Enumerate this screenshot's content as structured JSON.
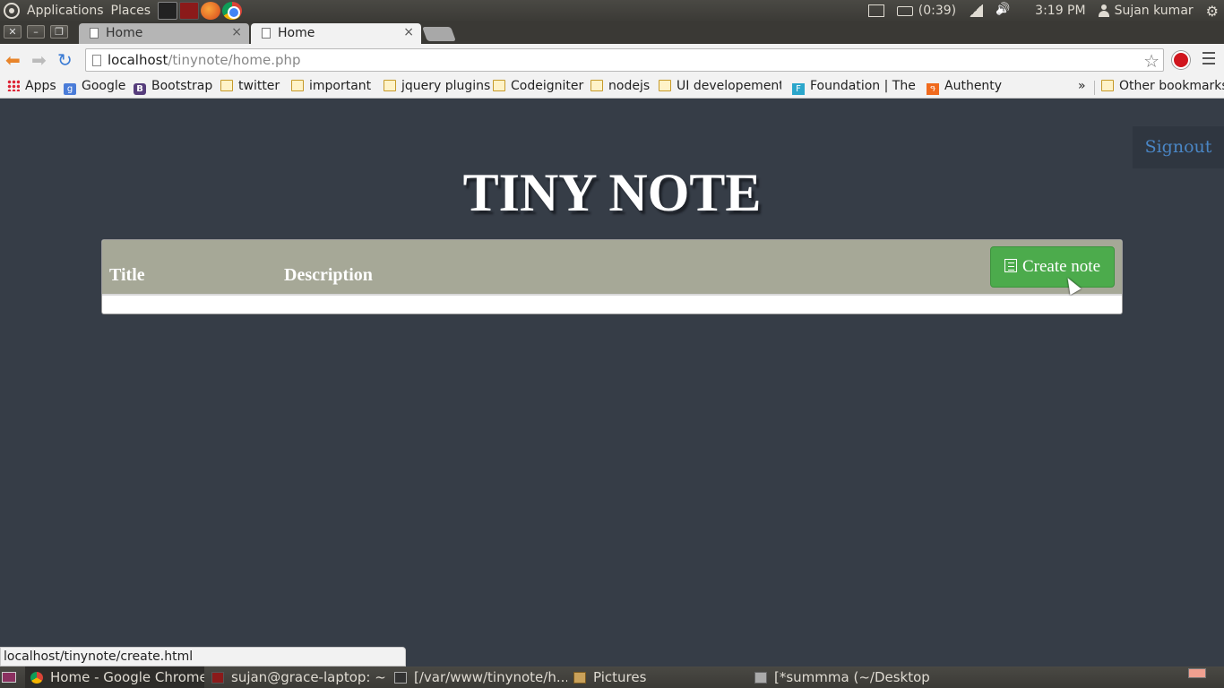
{
  "system_panel": {
    "applications": "Applications",
    "places": "Places",
    "battery": "(0:39)",
    "clock": "3:19 PM",
    "user": "Sujan kumar"
  },
  "browser": {
    "tabs": [
      {
        "label": "Home",
        "active": false
      },
      {
        "label": "Home",
        "active": true
      }
    ],
    "url_host": "localhost",
    "url_path": "/tinynote/home.php",
    "bookmarks": [
      {
        "label": "Apps",
        "icon": "apps-icon"
      },
      {
        "label": "Google",
        "icon": "google-icon"
      },
      {
        "label": "Bootstrap",
        "icon": "bootstrap-icon"
      },
      {
        "label": "twitter",
        "icon": "folder-icon"
      },
      {
        "label": "important",
        "icon": "folder-icon"
      },
      {
        "label": "jquery plugins",
        "icon": "folder-icon"
      },
      {
        "label": "Codeigniter",
        "icon": "folder-icon"
      },
      {
        "label": "nodejs",
        "icon": "folder-icon"
      },
      {
        "label": "UI developement t",
        "icon": "folder-icon"
      },
      {
        "label": "Foundation | The M",
        "icon": "foundation-icon"
      },
      {
        "label": "Authenty",
        "icon": "authenty-icon"
      }
    ],
    "bookmarks_overflow": "»",
    "other_bookmarks": "Other bookmarks",
    "status_url": "localhost/tinynote/create.html"
  },
  "page": {
    "signout": "Signout",
    "title": "TINY NOTE",
    "table": {
      "columns": [
        "Title",
        "Description"
      ],
      "create_button": "Create note"
    },
    "colors": {
      "background": "#363d47",
      "table_header": "#a6a897",
      "create_button": "#4cab4c",
      "signout_link": "#4a86c5"
    }
  },
  "taskbar": {
    "tasks": [
      {
        "label": "Home - Google Chrome",
        "icon": "chrome-icon",
        "active": true
      },
      {
        "label": "sujan@grace-laptop: ~",
        "icon": "terminal-icon",
        "active": false
      },
      {
        "label": "[/var/www/tinynote/h...",
        "icon": "editor-icon",
        "active": false
      },
      {
        "label": "Pictures",
        "icon": "folder-icon",
        "active": false
      },
      {
        "label": "[*summma (~/Desktop...",
        "icon": "gedit-icon",
        "active": false
      }
    ]
  }
}
